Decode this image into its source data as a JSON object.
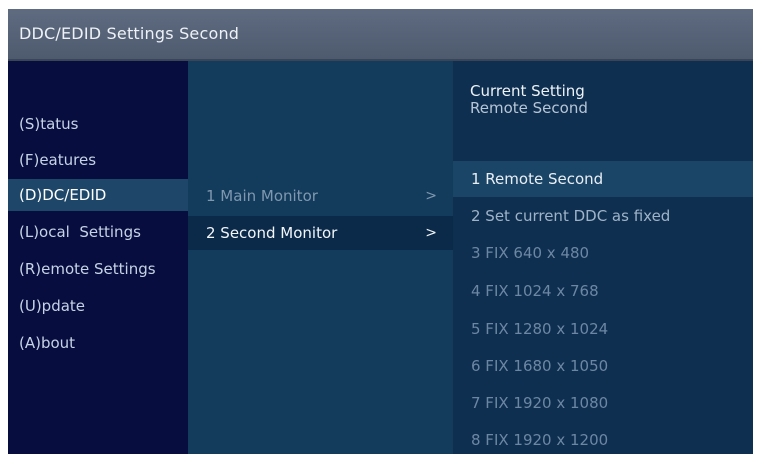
{
  "title": "DDC/EDID Settings Second",
  "main_menu": [
    {
      "label": "(S)tatus",
      "selected": false
    },
    {
      "label": "(F)eatures",
      "selected": false
    },
    {
      "label": "(D)DC/EDID",
      "selected": true
    },
    {
      "label": "(L)ocal  Settings",
      "selected": false
    },
    {
      "label": "(R)emote Settings",
      "selected": false
    },
    {
      "label": "(U)pdate",
      "selected": false
    },
    {
      "label": "(A)bout",
      "selected": false
    }
  ],
  "submenu": [
    {
      "label": "1 Main Monitor",
      "chevron": ">",
      "selected": false
    },
    {
      "label": "2 Second Monitor",
      "chevron": ">",
      "selected": true
    }
  ],
  "current_setting": {
    "heading": "Current Setting",
    "value": "Remote Second"
  },
  "options": [
    "1 Remote Second",
    "2 Set current DDC as fixed",
    "3 FIX 640 x 480",
    "4 FIX 1024 x 768",
    "5 FIX 1280 x 1024",
    "6 FIX 1680 x 1050",
    "7 FIX 1920 x 1080",
    "8 FIX 1920 x 1200"
  ],
  "colors": {
    "title_bar": "#56627a",
    "menu_background": "#080d40",
    "submenu_background": "#133c5c",
    "options_background": "#0f2f50",
    "highlight": "#1d4668"
  }
}
